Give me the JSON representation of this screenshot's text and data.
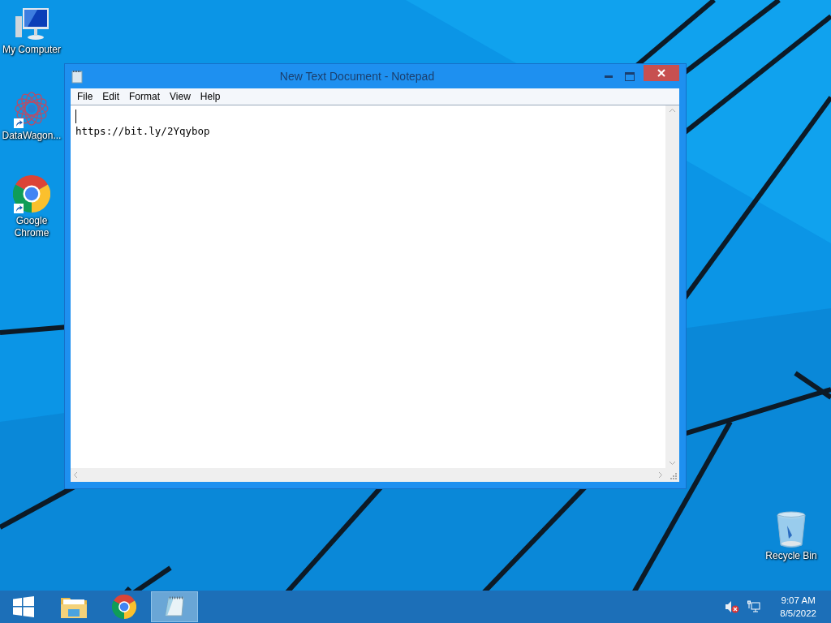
{
  "desktop_icons": [
    {
      "kind": "computer",
      "label": "My Computer"
    },
    {
      "kind": "shortcut-app",
      "label": "DataWagon..."
    },
    {
      "kind": "chrome",
      "label": "Google Chrome"
    },
    {
      "kind": "recycle-bin",
      "label": "Recycle Bin"
    }
  ],
  "window": {
    "title": "New Text Document - Notepad",
    "menu": [
      "File",
      "Edit",
      "Format",
      "View",
      "Help"
    ],
    "text": "https://bit.ly/2Yqybop"
  },
  "taskbar": {
    "items": [
      {
        "kind": "start",
        "selected": false
      },
      {
        "kind": "explorer",
        "selected": false
      },
      {
        "kind": "chrome",
        "selected": false
      },
      {
        "kind": "notepad",
        "selected": true
      }
    ],
    "time": "9:07 AM",
    "date": "8/5/2022"
  }
}
